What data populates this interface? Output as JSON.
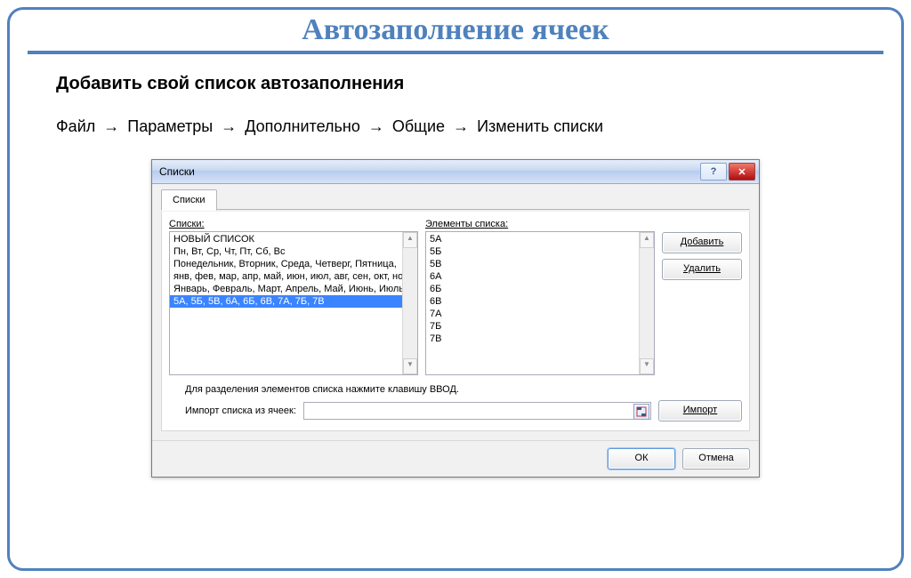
{
  "slide": {
    "title": "Автозаполнение ячеек",
    "subheading": "Добавить свой список автозаполнения",
    "path": [
      "Файл",
      "Параметры",
      "Дополнительно",
      "Общие",
      "Изменить списки"
    ],
    "arrow": "→"
  },
  "dialog": {
    "title": "Списки",
    "help_symbol": "?",
    "close_symbol": "✕",
    "tab": "Списки",
    "lists_label": "Списки:",
    "elements_label": "Элементы списка:",
    "lists": [
      "НОВЫЙ СПИСОК",
      "Пн, Вт, Ср, Чт, Пт, Сб, Вс",
      "Понедельник, Вторник, Среда, Четверг, Пятница,",
      "янв, фев, мар, апр, май, июн, июл, авг, сен, окт, но",
      "Январь, Февраль, Март, Апрель, Май, Июнь, Июль",
      "5А, 5Б, 5В, 6А, 6Б, 6В, 7А, 7Б, 7В"
    ],
    "selected_list_index": 5,
    "elements": [
      "5А",
      "5Б",
      "5В",
      "6А",
      "6Б",
      "6В",
      "7А",
      "7Б",
      "7В"
    ],
    "btn_add": "Добавить",
    "btn_delete": "Удалить",
    "hint": "Для разделения элементов списка нажмите клавишу ВВОД.",
    "import_label": "Импорт списка из ячеек:",
    "btn_import": "Импорт",
    "btn_ok": "ОК",
    "btn_cancel": "Отмена"
  }
}
